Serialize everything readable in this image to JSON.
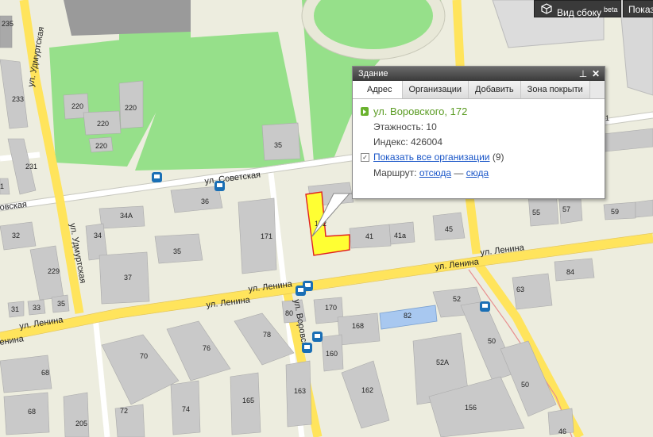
{
  "toolbar": {
    "side_view_label": "Вид сбоку",
    "side_view_badge": "beta",
    "show_label": "Показ"
  },
  "popup": {
    "title": "Здание",
    "tabs": [
      "Адрес",
      "Организации",
      "Добавить",
      "Зона покрыти"
    ],
    "address": "ул. Воровского, 172",
    "floors": "Этажность: 10",
    "index": "Индекс: 426004",
    "show_all_orgs": "Показать все организации",
    "orgs_count": "(9)",
    "route_label": "Маршрут:",
    "route_from": "отсюда",
    "route_dash": "—",
    "route_to": "сюда"
  },
  "map": {
    "streets": {
      "udmurtskaya_top": "ул. Удмуртская",
      "udmurtskaya_mid": "ул. Удмуртская",
      "sovetskaya": "ул. Советская",
      "sovetskaya_left": "овская",
      "lenina_1": "ул. Ленина",
      "lenina_2": "ул. Ленина",
      "lenina_3": "ул. Ленина",
      "lenina_4": "ул. Ленина",
      "lenina_5": "ул. Ленина",
      "lenina_left": "енина",
      "vorovskogo": "ул. Воровско"
    },
    "buildings": [
      "235",
      "233",
      "231",
      "1",
      "32",
      "229",
      "31",
      "33",
      "35",
      "220",
      "220",
      "220",
      "220",
      "35",
      "36",
      "34А",
      "34",
      "35",
      "37",
      "171",
      "172",
      "41",
      "41а",
      "45",
      "55",
      "57",
      "59",
      "84",
      "63",
      "70",
      "76",
      "78",
      "80",
      "170",
      "168",
      "82",
      "160",
      "52",
      "50",
      "52А",
      "162",
      "156",
      "46",
      "163",
      "165",
      "74",
      "72",
      "205",
      "68",
      "68",
      "50",
      "1"
    ],
    "colors": {
      "highlight": "#ffff33",
      "highlight_border": "#e02020",
      "park": "#96e08a",
      "road": "#ffe45c",
      "bus_stop": "#1a6fb5"
    }
  }
}
